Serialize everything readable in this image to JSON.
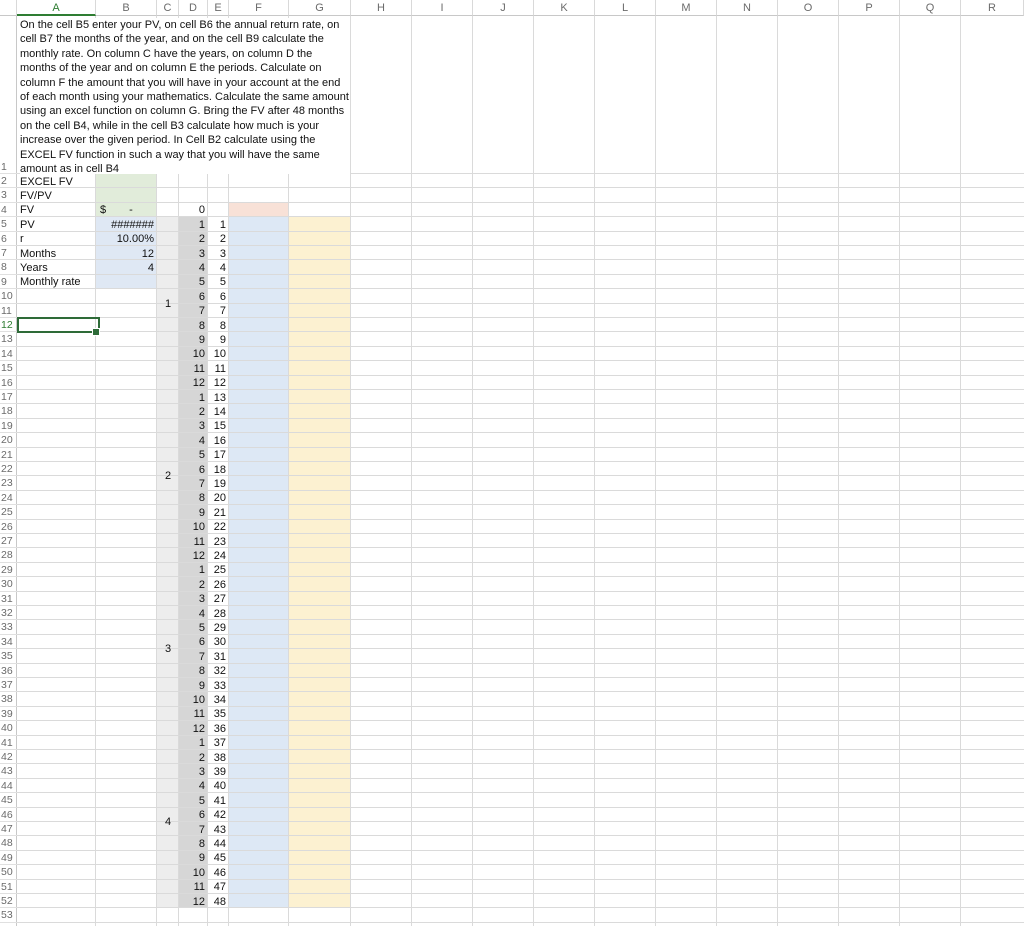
{
  "columns": [
    "A",
    "B",
    "C",
    "D",
    "E",
    "F",
    "G",
    "H",
    "I",
    "J",
    "K",
    "L",
    "M",
    "N",
    "O",
    "P",
    "Q",
    "R"
  ],
  "selected_column": "A",
  "selected_row": 12,
  "rows_visible": 53,
  "instructions": "On the cell B5 enter your PV, on cell B6 the annual return rate, on cell B7 the months of the year, and on the cell B9 calculate the monthly rate.  On column C have the years, on column D the months of the year and on column E the periods.  Calculate on column F the amount that you will have in your account at the end of each month using your mathematics. Calculate the same amount using an excel function on column G.  Bring the FV after 48 months on the cell B4, while in the cell B3 calculate how much is your increase over the given period.  In Cell B2 calculate using the EXCEL FV function in such a way that you will have the same amount as in cell B4",
  "labels": {
    "a2": "EXCEL FV",
    "a3": "FV/PV",
    "a4": "FV",
    "a5": "PV",
    "a6": "r",
    "a7": "Months",
    "a8": "Years",
    "a9": "Monthly rate"
  },
  "values": {
    "b4_currency": "$",
    "b4_value": "-",
    "b5": "#######",
    "b6": "10.00%",
    "b7": "12",
    "b8": "4",
    "d4": "0"
  },
  "years": [
    "1",
    "2",
    "3",
    "4"
  ],
  "months": [
    "1",
    "2",
    "3",
    "4",
    "5",
    "6",
    "7",
    "8",
    "9",
    "10",
    "11",
    "12",
    "1",
    "2",
    "3",
    "4",
    "5",
    "6",
    "7",
    "8",
    "9",
    "10",
    "11",
    "12",
    "1",
    "2",
    "3",
    "4",
    "5",
    "6",
    "7",
    "8",
    "9",
    "10",
    "11",
    "12",
    "1",
    "2",
    "3",
    "4",
    "5",
    "6",
    "7",
    "8",
    "9",
    "10",
    "11",
    "12"
  ],
  "periods": [
    "1",
    "2",
    "3",
    "4",
    "5",
    "6",
    "7",
    "8",
    "9",
    "10",
    "11",
    "12",
    "13",
    "14",
    "15",
    "16",
    "17",
    "18",
    "19",
    "20",
    "21",
    "22",
    "23",
    "24",
    "25",
    "26",
    "27",
    "28",
    "29",
    "30",
    "31",
    "32",
    "33",
    "34",
    "35",
    "36",
    "37",
    "38",
    "39",
    "40",
    "41",
    "42",
    "43",
    "44",
    "45",
    "46",
    "47",
    "48"
  ],
  "colors": {
    "input_fill": "#dfe8f4",
    "output_fill": "#e1ecda",
    "month_col_fill": "#d6d6d6",
    "year_col_fill": "#ededed",
    "f_fill": "#dde8f5",
    "g_fill": "#fcf1d1",
    "f4_fill": "#f8e1d7",
    "selection": "#2e6b38"
  }
}
